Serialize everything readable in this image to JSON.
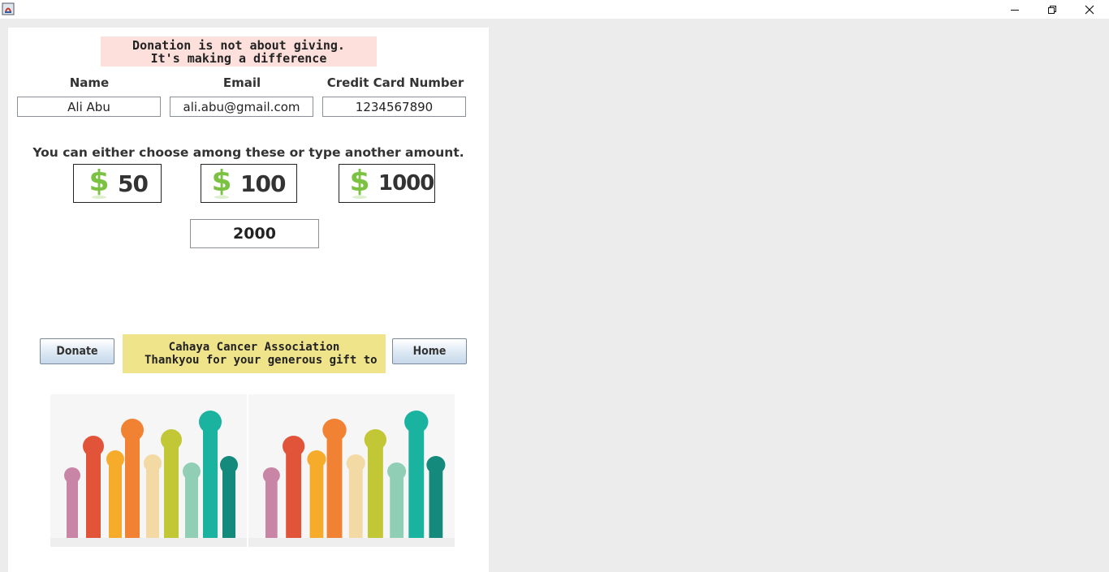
{
  "motto": {
    "line1": "Donation is not about giving.",
    "line2": "It's making a difference"
  },
  "form": {
    "name_label": "Name",
    "email_label": "Email",
    "card_label": "Credit Card Number",
    "name_value": "Ali Abu",
    "email_value": "ali.abu@gmail.com",
    "card_value": "1234567890"
  },
  "instruction": "You can either choose among these or type another amount.",
  "amounts": [
    {
      "value": "50",
      "icon": "dollar-icon"
    },
    {
      "value": "100",
      "icon": "dollar-icon"
    },
    {
      "value": "1000",
      "icon": "dollar-icon"
    }
  ],
  "custom_amount": "2000",
  "buttons": {
    "donate": "Donate",
    "home": "Home"
  },
  "thanks": {
    "line1": "Cahaya Cancer Association",
    "line2": "Thankyou for your generous gift to"
  },
  "colors": {
    "motto_bg": "#fde0dc",
    "thanks_bg": "#f0e48a",
    "dollar_green": "#7cc242"
  }
}
